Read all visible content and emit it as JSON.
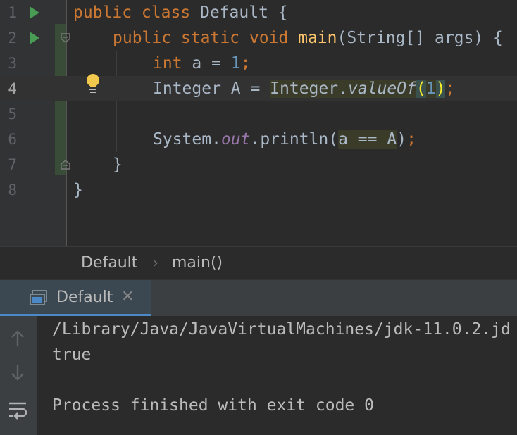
{
  "editor": {
    "lines": [
      {
        "num": "1"
      },
      {
        "num": "2"
      },
      {
        "num": "3"
      },
      {
        "num": "4"
      },
      {
        "num": "5"
      },
      {
        "num": "6"
      },
      {
        "num": "7"
      },
      {
        "num": "8"
      }
    ],
    "tokens": {
      "l1_kw": "public class ",
      "l1_name": "Default {",
      "l2_kw": "public static void ",
      "l2_fn": "main",
      "l2_rest": "(String[] args) {",
      "l3_kw": "int ",
      "l3_rest": "a = ",
      "l3_num": "1",
      "l3_semi": ";",
      "l4_var": "Integer A = ",
      "l4_cls": "Integer.",
      "l4_method": "valueOf",
      "l4_open": "(",
      "l4_num": "1",
      "l4_close": ")",
      "l4_semi": ";",
      "l6_sys": "System.",
      "l6_field": "out",
      "l6_call": ".println(",
      "l6_expr": "a == A",
      "l6_close": ")",
      "l6_semi": ";",
      "l7_brace": "}",
      "l8_brace": "}"
    }
  },
  "breadcrumb": {
    "class_name": "Default",
    "separator": "›",
    "method_name": "main()"
  },
  "run_panel": {
    "tab_label": "Default",
    "tab_close": "×",
    "output": [
      "/Library/Java/JavaVirtualMachines/jdk-11.0.2.jd",
      "true",
      "",
      "Process finished with exit code 0"
    ]
  },
  "icons": {
    "run": "run-gutter-icon",
    "bulb": "intention-bulb-icon",
    "fold": "fold-icon",
    "console_tab": "console-icon",
    "up": "arrow-up-icon",
    "down": "arrow-down-icon",
    "wrap": "soft-wrap-icon"
  },
  "colors": {
    "keyword": "#cc7832",
    "number": "#6897bb",
    "method": "#ffc66d",
    "field": "#9876aa",
    "text": "#a9b7c6",
    "run_green": "#499c54",
    "tab_accent": "#4a88c7"
  }
}
